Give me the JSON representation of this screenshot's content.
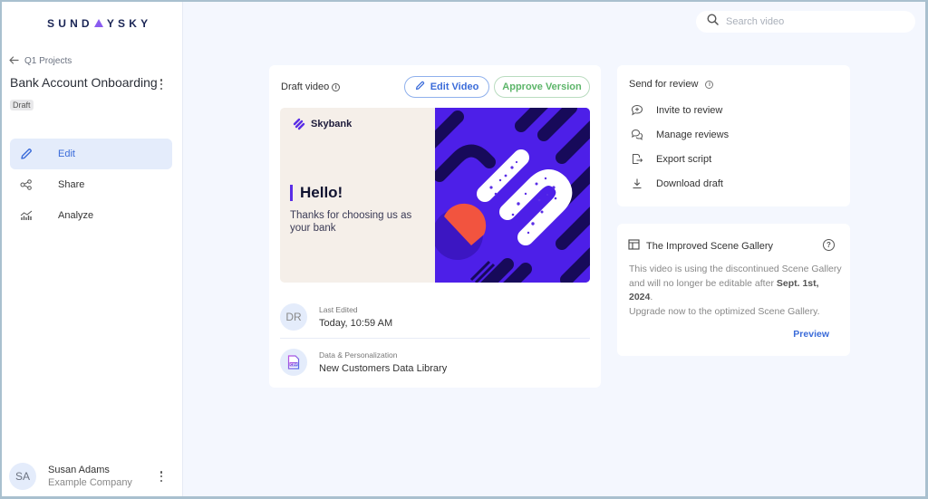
{
  "brand": {
    "logo_pre": "SUND",
    "logo_post": "YSKY"
  },
  "sidebar": {
    "back_label": "Q1 Projects",
    "project_title": "Bank Account Onboarding",
    "status_badge": "Draft",
    "nav": [
      {
        "label": "Edit",
        "icon": "pencil-icon",
        "active": true
      },
      {
        "label": "Share",
        "icon": "share-icon",
        "active": false
      },
      {
        "label": "Analyze",
        "icon": "chart-icon",
        "active": false
      }
    ],
    "user": {
      "initials": "SA",
      "name": "Susan Adams",
      "company": "Example Company"
    }
  },
  "search": {
    "placeholder": "Search video",
    "value": ""
  },
  "video_card": {
    "title": "Draft video",
    "edit_button": "Edit Video",
    "approve_button": "Approve Version",
    "thumbnail": {
      "brand": "Skybank",
      "headline": "Hello!",
      "subtext": "Thanks for choosing us as your bank"
    },
    "last_edited": {
      "initials": "DR",
      "label": "Last Edited",
      "value": "Today, 10:59 AM"
    },
    "data_personalization": {
      "label": "Data & Personalization",
      "value": "New Customers Data Library",
      "icon_text": "CSV"
    }
  },
  "review_card": {
    "title": "Send for review",
    "items": [
      {
        "label": "Invite to review",
        "icon": "comment-plus-icon"
      },
      {
        "label": "Manage reviews",
        "icon": "chats-icon"
      },
      {
        "label": "Export script",
        "icon": "export-icon"
      },
      {
        "label": "Download draft",
        "icon": "download-icon"
      }
    ]
  },
  "gallery_card": {
    "title": "The Improved Scene Gallery",
    "body_1": "This video is using the discontinued Scene Gallery and will no longer be editable after ",
    "date": "Sept. 1st, 2024",
    "body_2": ".",
    "body_3": "Upgrade now to the optimized Scene Gallery.",
    "preview_link": "Preview"
  },
  "colors": {
    "accent": "#3a6bd9",
    "approve": "#5cb569",
    "background": "#f4f7fe",
    "active_nav": "#e4ecfb"
  }
}
